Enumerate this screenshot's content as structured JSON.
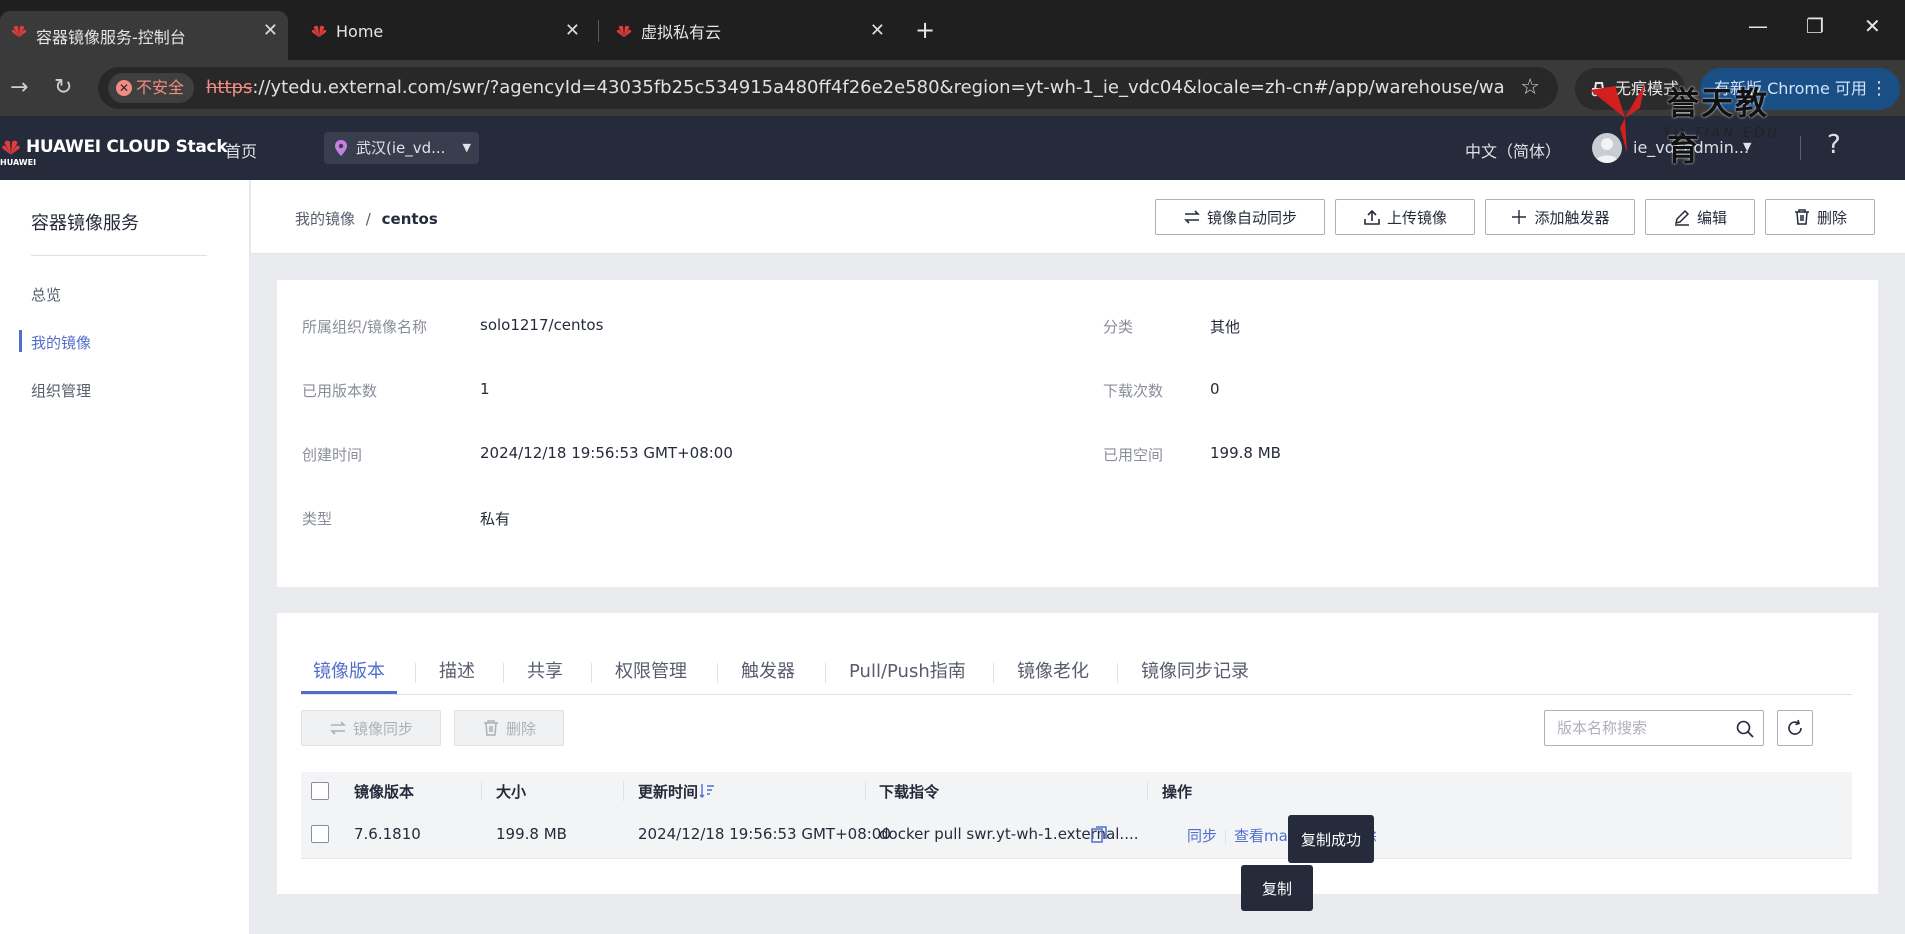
{
  "browser": {
    "tabs": [
      {
        "title": "容器镜像服务-控制台",
        "active": true
      },
      {
        "title": "Home",
        "active": false
      },
      {
        "title": "虚拟私有云",
        "active": false
      }
    ],
    "insecure_label": "不安全",
    "url_scheme": "https",
    "url_rest": "://ytedu.external.com/swr/?agencyId=43035fb25c534915a480ff4f26e2e580&region=yt-wh-1_ie_vdc04&locale=zh-cn#/app/warehouse/warehou...",
    "incognito_label": "无痕模式",
    "update_label": "有新版 Chrome 可用"
  },
  "watermark": {
    "cn": "誉天教育",
    "en": "YU TIAN EDU"
  },
  "header": {
    "logo_text": "HUAWEI CLOUD Stack",
    "logo_sub": "HUAWEI",
    "home": "首页",
    "region": "武汉(ie_vd...",
    "language": "中文（简体）",
    "username": "ie_vdcadmin...",
    "help": "?"
  },
  "sidebar": {
    "title": "容器镜像服务",
    "items": [
      {
        "label": "总览",
        "active": false
      },
      {
        "label": "我的镜像",
        "active": true
      },
      {
        "label": "组织管理",
        "active": false
      }
    ]
  },
  "page": {
    "breadcrumb_parent": "我的镜像",
    "breadcrumb_sep": "/",
    "breadcrumb_current": "centos",
    "buttons": {
      "auto_sync": "镜像自动同步",
      "upload": "上传镜像",
      "add_trigger": "添加触发器",
      "edit": "编辑",
      "delete": "删除"
    }
  },
  "details": {
    "org_image_label": "所属组织/镜像名称",
    "org_image_value": "solo1217/centos",
    "category_label": "分类",
    "category_value": "其他",
    "versions_label": "已用版本数",
    "versions_value": "1",
    "downloads_label": "下载次数",
    "downloads_value": "0",
    "created_label": "创建时间",
    "created_value": "2024/12/18 19:56:53 GMT+08:00",
    "space_label": "已用空间",
    "space_value": "199.8 MB",
    "type_label": "类型",
    "type_value": "私有"
  },
  "versions": {
    "tabs": [
      "镜像版本",
      "描述",
      "共享",
      "权限管理",
      "触发器",
      "Pull/Push指南",
      "镜像老化",
      "镜像同步记录"
    ],
    "sync_button": "镜像同步",
    "delete_button": "删除",
    "search_placeholder": "版本名称搜索",
    "columns": {
      "version": "镜像版本",
      "size": "大小",
      "updated": "更新时间",
      "command": "下载指令",
      "ops": "操作"
    },
    "row": {
      "version": "7.6.1810",
      "size": "199.8 MB",
      "updated": "2024/12/18 19:56:53 GMT+08:00",
      "command": "docker pull swr.yt-wh-1.external....",
      "op_sync": "同步",
      "op_manifest": "查看manifest",
      "op_delete": "删除"
    },
    "tooltip_copied": "复制成功",
    "tooltip_copy": "复制"
  },
  "colors": {
    "accent": "#526ecc",
    "header_bg": "#252b3a",
    "chrome_bg": "#3a3a3a",
    "insecure": "#f28b82"
  }
}
